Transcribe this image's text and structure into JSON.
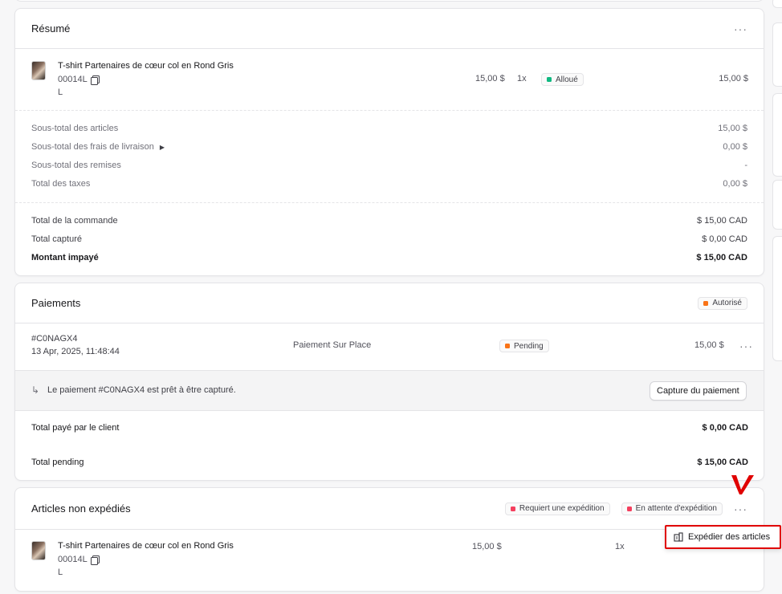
{
  "summary": {
    "title": "Résumé",
    "item": {
      "name": "T-shirt Partenaires de cœur col en Rond Gris",
      "sku": "00014L",
      "variant": "L",
      "unit_price": "15,00 $",
      "qty": "1x",
      "status": "Alloué",
      "total": "15,00 $"
    },
    "subtotals": [
      {
        "label": "Sous-total des articles",
        "value": "15,00 $"
      },
      {
        "label": "Sous-total des frais de livraison",
        "value": "0,00 $"
      },
      {
        "label": "Sous-total des remises",
        "value": "-"
      },
      {
        "label": "Total des taxes",
        "value": "0,00 $"
      }
    ],
    "totals": [
      {
        "label": "Total de la commande",
        "value": "$ 15,00 CAD"
      },
      {
        "label": "Total capturé",
        "value": "$ 0,00 CAD"
      },
      {
        "label": "Montant impayé",
        "value": "$ 15,00 CAD"
      }
    ]
  },
  "payments": {
    "title": "Paiements",
    "status_badge": "Autorisé",
    "payment": {
      "id": "#C0NAGX4",
      "date": "13 Apr, 2025, 11:48:44",
      "method": "Paiement Sur Place",
      "status": "Pending",
      "amount": "15,00 $"
    },
    "capture_notice": "Le paiement #C0NAGX4 est prêt à être capturé.",
    "capture_button": "Capture du paiement",
    "paid_label": "Total payé par le client",
    "paid_value": "$ 0,00 CAD",
    "pending_label": "Total pending",
    "pending_value": "$ 15,00 CAD"
  },
  "unshipped": {
    "title": "Articles non expédiés",
    "badge_requires": "Requiert une expédition",
    "badge_waiting": "En attente d'expédition",
    "item": {
      "name": "T-shirt Partenaires de cœur col en Rond Gris",
      "sku": "00014L",
      "variant": "L",
      "unit_price": "15,00 $",
      "qty": "1x"
    },
    "menu_item": "Expédier des articles"
  },
  "colors": {
    "allocated": "#10b981",
    "authorized": "#f97316",
    "pending": "#f97316",
    "requires": "#f43f5e",
    "highlight": "#e00000"
  }
}
